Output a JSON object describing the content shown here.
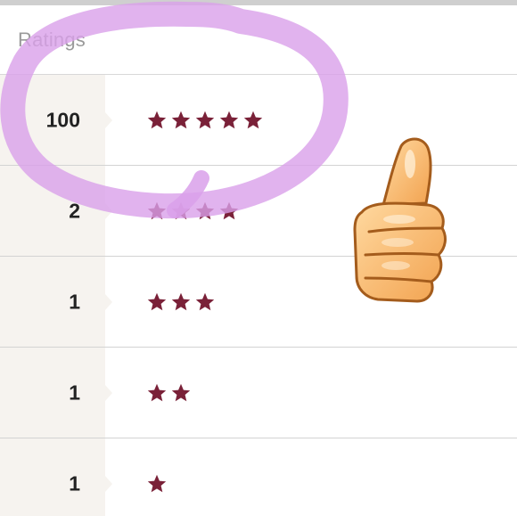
{
  "header": {
    "title": "Ratings"
  },
  "ratings": [
    {
      "count": "100",
      "stars": 5
    },
    {
      "count": "2",
      "stars": 4
    },
    {
      "count": "1",
      "stars": 3
    },
    {
      "count": "1",
      "stars": 2
    },
    {
      "count": "1",
      "stars": 1
    }
  ],
  "colors": {
    "star": "#7a2138",
    "annotation": "#d9a0ea",
    "count_bg": "#f6f3ef",
    "title": "#9a9a9a"
  },
  "annotations": {
    "circle_marker": "purple-circle-annotation",
    "thumbs_up": "thumbs-up-emoji-icon"
  }
}
